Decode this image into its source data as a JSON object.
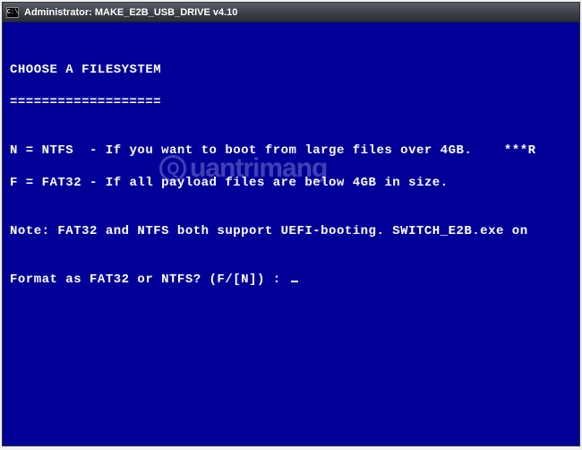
{
  "titlebar": {
    "icon_label": "C:\\",
    "title": "Administrator:  MAKE_E2B_USB_DRIVE v4.10"
  },
  "console": {
    "blank0": "",
    "heading": "CHOOSE A FILESYSTEM",
    "heading_underline": "===================",
    "blank1": "",
    "line_n": "N = NTFS  - If you want to boot from large files over 4GB.    ***R",
    "line_f": "F = FAT32 - If all payload files are below 4GB in size.",
    "blank2": "",
    "note": "Note: FAT32 and NTFS both support UEFI-booting. SWITCH_E2B.exe on",
    "blank3": "",
    "prompt": "Format as FAT32 or NTFS? (F/[N]) : "
  },
  "watermark": {
    "text": "uantrimang"
  }
}
